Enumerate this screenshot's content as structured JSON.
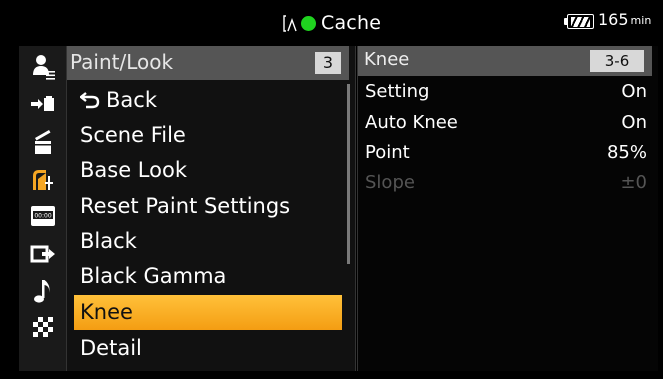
{
  "status": {
    "title": "Cache",
    "rec_color": "#1fd31f",
    "battery_value": "165",
    "battery_unit": "min"
  },
  "icons": [
    "user-icon",
    "media-transfer-icon",
    "clapper-icon",
    "paint-icon",
    "timecode-icon",
    "output-icon",
    "audio-icon",
    "checker-icon"
  ],
  "menu": {
    "header_title": "Paint/Look",
    "header_page": "3",
    "items": [
      {
        "label": "Back"
      },
      {
        "label": "Scene File"
      },
      {
        "label": "Base Look"
      },
      {
        "label": "Reset Paint Settings"
      },
      {
        "label": "Black"
      },
      {
        "label": "Black Gamma"
      },
      {
        "label": "Knee"
      },
      {
        "label": "Detail"
      }
    ],
    "selected_index": 6,
    "accent_color": "#f5a623"
  },
  "detail": {
    "header_title": "Knee",
    "header_page": "3-6",
    "rows": [
      {
        "label": "Setting",
        "value": "On"
      },
      {
        "label": "Auto Knee",
        "value": "On"
      },
      {
        "label": "Point",
        "value": "85%"
      },
      {
        "label": "Slope",
        "value": "±0"
      }
    ]
  }
}
